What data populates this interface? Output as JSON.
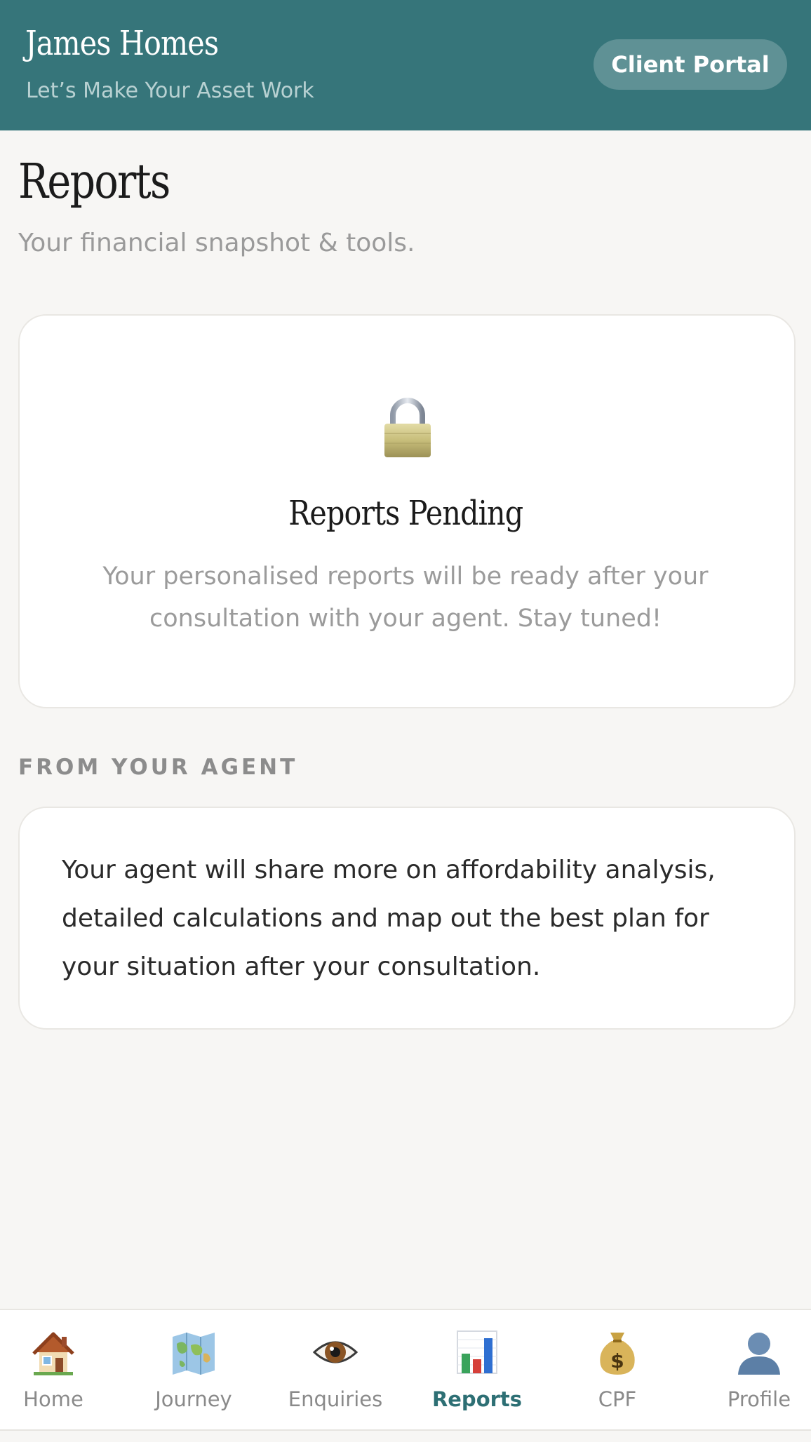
{
  "header": {
    "brand_title": "James Homes",
    "tagline": "Let’s Make Your Asset Work",
    "portal_button": "Client Portal"
  },
  "page": {
    "title": "Reports",
    "subtitle": "Your financial snapshot & tools."
  },
  "pending_card": {
    "icon": "lock-icon",
    "title": "Reports Pending",
    "body": "Your personalised reports will be ready after your consultation with your agent. Stay tuned!"
  },
  "agent_section": {
    "label": "FROM YOUR AGENT",
    "text": "Your agent will share more on affordability analysis, detailed calculations and map out the best plan for your situation after your consultation."
  },
  "nav": {
    "active": "Reports",
    "items": [
      {
        "label": "Home",
        "icon": "house-icon"
      },
      {
        "label": "Journey",
        "icon": "map-icon"
      },
      {
        "label": "Enquiries",
        "icon": "eye-icon"
      },
      {
        "label": "Reports",
        "icon": "bar-chart-icon"
      },
      {
        "label": "CPF",
        "icon": "money-bag-icon"
      },
      {
        "label": "Profile",
        "icon": "profile-icon"
      }
    ]
  },
  "colors": {
    "header_bg": "#36757a",
    "accent": "#2d6f74",
    "page_bg": "#f7f6f4"
  }
}
